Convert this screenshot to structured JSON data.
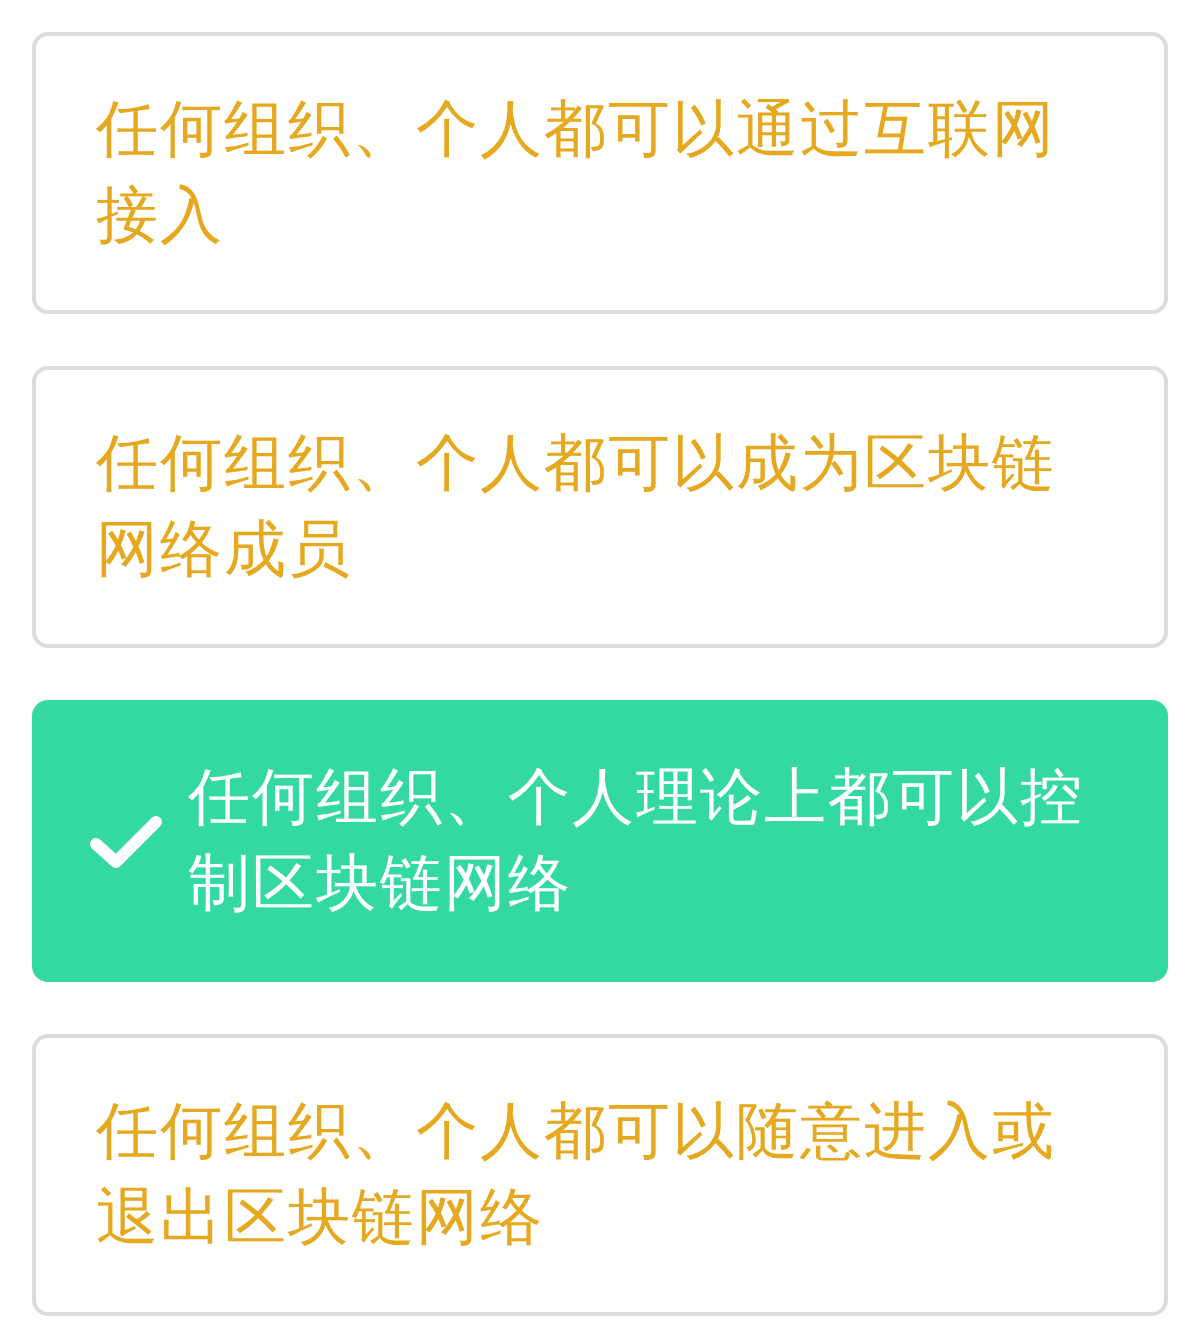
{
  "options": [
    {
      "text": "任何组织、个人都可以通过互联网接入",
      "selected": false
    },
    {
      "text": "任何组织、个人都可以成为区块链网络成员",
      "selected": false
    },
    {
      "text": "任何组织、个人理论上都可以控制区块链网络",
      "selected": true
    },
    {
      "text": "任何组织、个人都可以随意进入或退出区块链网络",
      "selected": false
    }
  ]
}
